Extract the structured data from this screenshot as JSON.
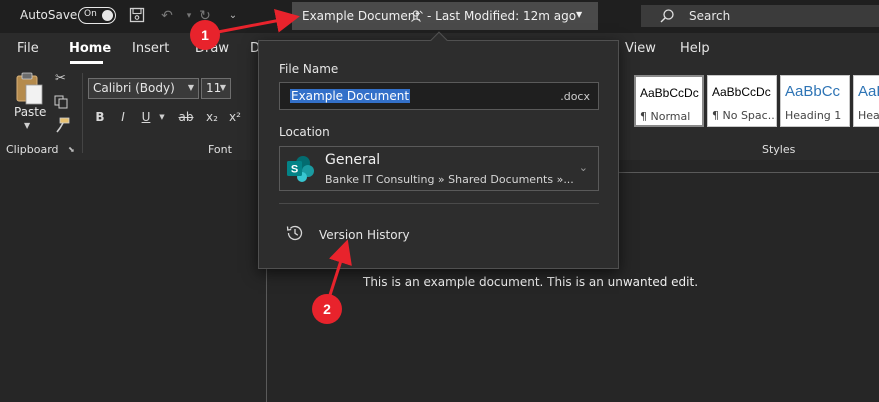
{
  "titlebar": {
    "autosave_label": "AutoSave",
    "autosave_state": "On",
    "doc_title": "Example Document",
    "last_modified": "- Last Modified: 12m ago",
    "search_label": "Search"
  },
  "ribbon": {
    "tabs": [
      "File",
      "Home",
      "Insert",
      "Draw",
      "D",
      "View",
      "Help"
    ],
    "active_tab": "Home",
    "clipboard": {
      "paste_label": "Paste",
      "group_label": "Clipboard"
    },
    "font": {
      "font_name": "Calibri (Body)",
      "font_size": "11",
      "group_label": "Font",
      "buttons": [
        "B",
        "I",
        "U",
        "ab",
        "x₂",
        "x²"
      ]
    },
    "styles": {
      "group_label": "Styles",
      "cards": [
        {
          "sample": "AaBbCcDc",
          "name": "¶ Normal",
          "selected": true
        },
        {
          "sample": "AaBbCcDc",
          "name": "¶ No Spac...",
          "selected": false
        },
        {
          "sample": "AaBbCc",
          "name": "Heading 1",
          "selected": false
        },
        {
          "sample": "AaBb",
          "name": "Hea",
          "selected": false
        }
      ]
    }
  },
  "popover": {
    "file_name_label": "File Name",
    "file_name_value": "Example Document",
    "file_ext": ".docx",
    "location_label": "Location",
    "location_name": "General",
    "location_path": "Banke IT Consulting » Shared Documents »...",
    "version_history_label": "Version History"
  },
  "document": {
    "body_text": "This is an example document. This is an unwanted edit."
  },
  "callouts": [
    {
      "number": "1"
    },
    {
      "number": "2"
    }
  ],
  "colors": {
    "accent_red": "#e8232c",
    "selection_blue": "#3370c9",
    "sharepoint_teal": "#038387"
  }
}
